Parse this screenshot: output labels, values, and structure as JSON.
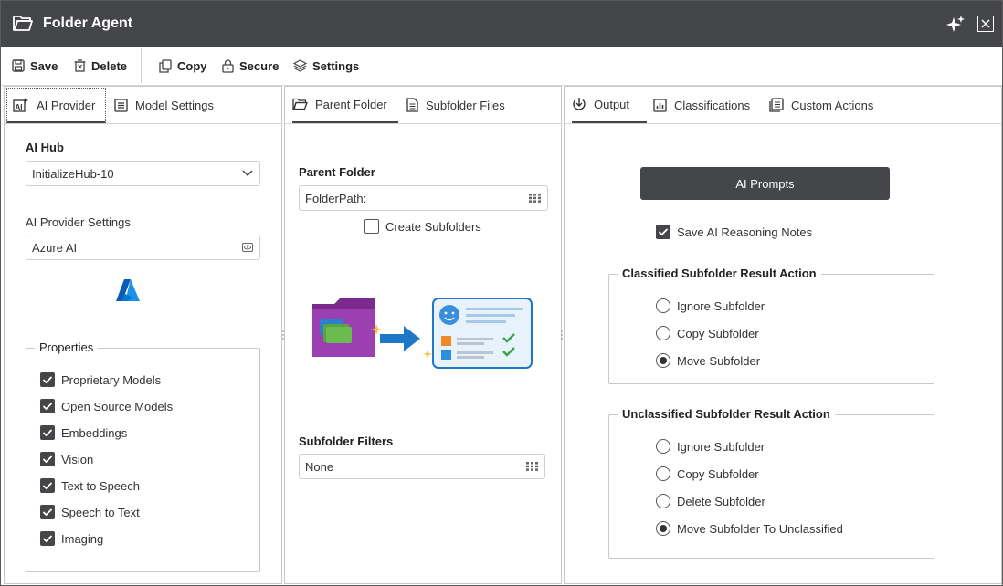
{
  "window": {
    "title": "Folder Agent"
  },
  "toolbar": {
    "save": "Save",
    "delete": "Delete",
    "copy": "Copy",
    "secure": "Secure",
    "settings": "Settings"
  },
  "left_panel": {
    "tabs": [
      "AI Provider",
      "Model Settings"
    ],
    "ai_hub_label": "AI Hub",
    "ai_hub_value": "InitializeHub-10",
    "provider_settings_label": "AI Provider Settings",
    "provider_settings_value": "Azure AI",
    "properties_legend": "Properties",
    "properties": [
      {
        "label": "Proprietary Models",
        "checked": true
      },
      {
        "label": "Open Source Models",
        "checked": true
      },
      {
        "label": "Embeddings",
        "checked": true
      },
      {
        "label": "Vision",
        "checked": true
      },
      {
        "label": "Text to Speech",
        "checked": true
      },
      {
        "label": "Speech to Text",
        "checked": true
      },
      {
        "label": "Imaging",
        "checked": true
      }
    ]
  },
  "middle_panel": {
    "tabs": [
      "Parent Folder",
      "Subfolder Files"
    ],
    "parent_folder_label": "Parent Folder",
    "parent_folder_value": "FolderPath:",
    "create_subfolders": "Create Subfolders",
    "subfolder_filters_label": "Subfolder Filters",
    "subfolder_filters_value": "None"
  },
  "right_panel": {
    "tabs": [
      "Output",
      "Classifications",
      "Custom Actions"
    ],
    "ai_prompts_button": "AI Prompts",
    "save_reasoning": "Save AI Reasoning Notes",
    "classified_legend": "Classified Subfolder Result Action",
    "classified_options": [
      {
        "label": "Ignore Subfolder",
        "selected": false
      },
      {
        "label": "Copy Subfolder",
        "selected": false
      },
      {
        "label": "Move Subfolder",
        "selected": true
      }
    ],
    "unclassified_legend": "Unclassified Subfolder Result Action",
    "unclassified_options": [
      {
        "label": "Ignore Subfolder",
        "selected": false
      },
      {
        "label": "Copy Subfolder",
        "selected": false
      },
      {
        "label": "Delete Subfolder",
        "selected": false
      },
      {
        "label": "Move Subfolder To Unclassified",
        "selected": true
      }
    ]
  },
  "colors": {
    "titlebar": "#454649",
    "accent": "#454649",
    "azure": "#0078d4"
  }
}
